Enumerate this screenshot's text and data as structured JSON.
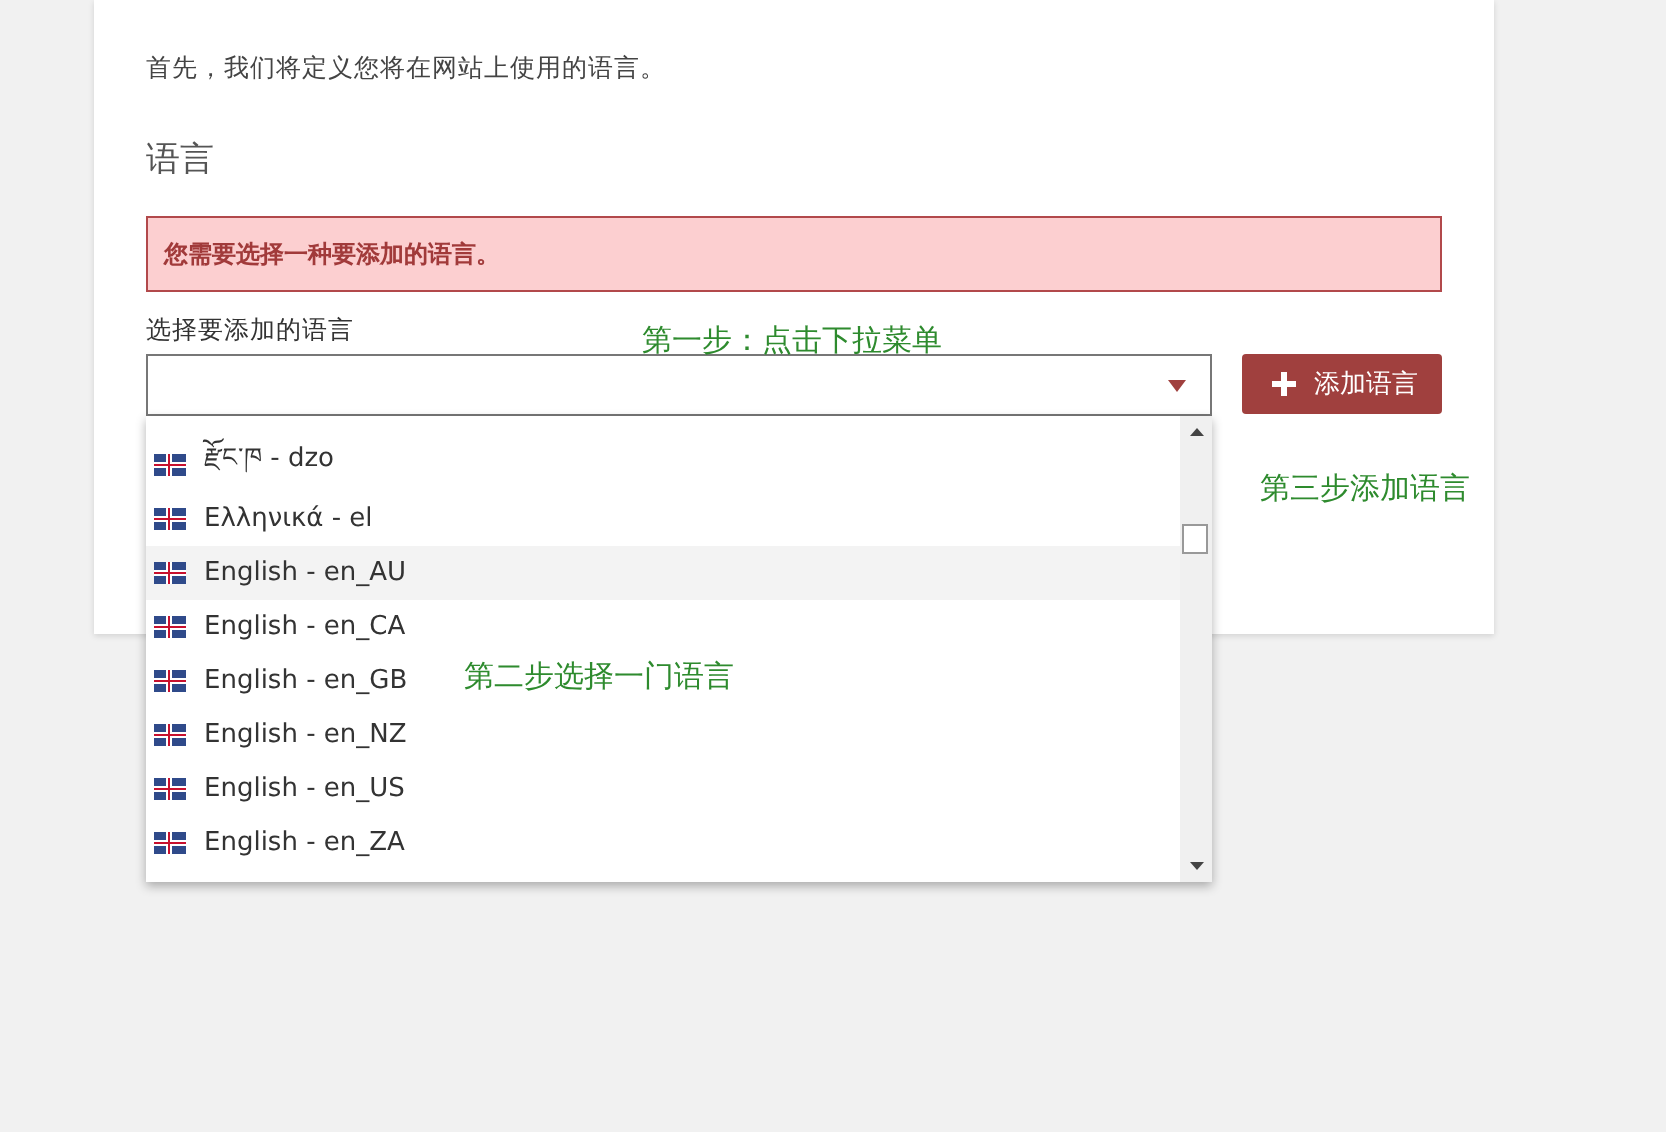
{
  "intro": "首先，我们将定义您将在网站上使用的语言。",
  "section_title": "语言",
  "error_message": "您需要选择一种要添加的语言。",
  "select": {
    "label": "选择要添加的语言",
    "expanded": true
  },
  "add_button": "添加语言",
  "dropdown_items": [
    {
      "label": "རྫོང་ཁ - dzo",
      "highlighted": false
    },
    {
      "label": "Ελληνικά - el",
      "highlighted": false
    },
    {
      "label": "English - en_AU",
      "highlighted": true
    },
    {
      "label": "English - en_CA",
      "highlighted": false
    },
    {
      "label": "English - en_GB",
      "highlighted": false
    },
    {
      "label": "English - en_NZ",
      "highlighted": false
    },
    {
      "label": "English - en_US",
      "highlighted": false
    },
    {
      "label": "English - en_ZA",
      "highlighted": false
    }
  ],
  "annotations": [
    "第一步：点击下拉菜单",
    "第二步选择一门语言",
    "第三步添加语言"
  ]
}
